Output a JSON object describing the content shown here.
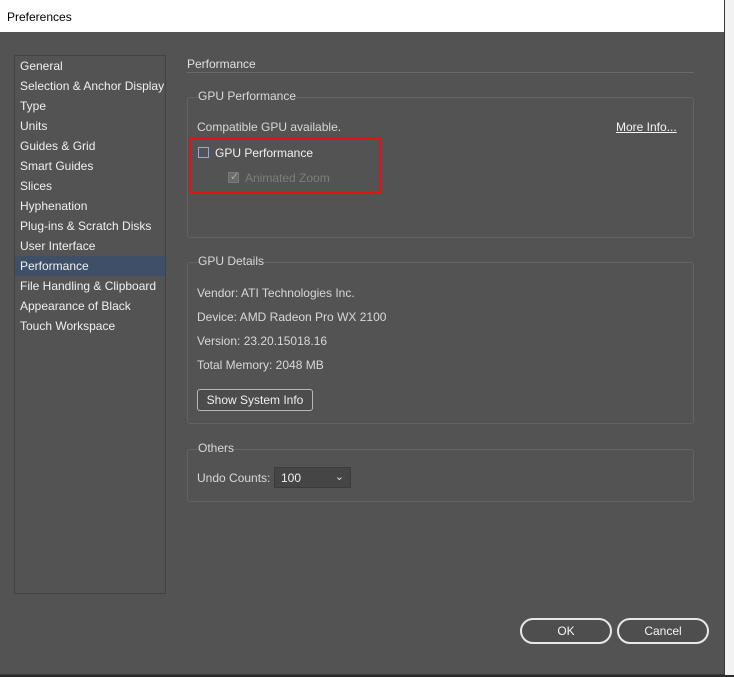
{
  "window": {
    "title": "Preferences"
  },
  "sidebar": {
    "items": [
      {
        "label": "General"
      },
      {
        "label": "Selection & Anchor Display"
      },
      {
        "label": "Type"
      },
      {
        "label": "Units"
      },
      {
        "label": "Guides & Grid"
      },
      {
        "label": "Smart Guides"
      },
      {
        "label": "Slices"
      },
      {
        "label": "Hyphenation"
      },
      {
        "label": "Plug-ins & Scratch Disks"
      },
      {
        "label": "User Interface"
      },
      {
        "label": "Performance",
        "selected": true
      },
      {
        "label": "File Handling & Clipboard"
      },
      {
        "label": "Appearance of Black"
      },
      {
        "label": "Touch Workspace"
      }
    ]
  },
  "main": {
    "title": "Performance",
    "gpu_performance": {
      "label": "GPU Performance",
      "status": "Compatible GPU available.",
      "more_info": "More Info...",
      "gpu_checkbox_label": "GPU Performance",
      "gpu_checkbox_checked": false,
      "animated_zoom_label": "Animated Zoom",
      "animated_zoom_checked": true,
      "animated_zoom_enabled": false
    },
    "gpu_details": {
      "label": "GPU Details",
      "vendor": "Vendor: ATI Technologies Inc.",
      "device": "Device: AMD Radeon Pro WX 2100",
      "version": "Version: 23.20.15018.16",
      "memory": "Total Memory: 2048 MB",
      "system_info_button": "Show System Info"
    },
    "others": {
      "label": "Others",
      "undo_label": "Undo Counts:",
      "undo_value": "100"
    }
  },
  "footer": {
    "ok": "OK",
    "cancel": "Cancel"
  },
  "colors": {
    "highlight_box": "#e3121a",
    "selected_item": "#3f4f67",
    "panel_bg": "#535353"
  }
}
